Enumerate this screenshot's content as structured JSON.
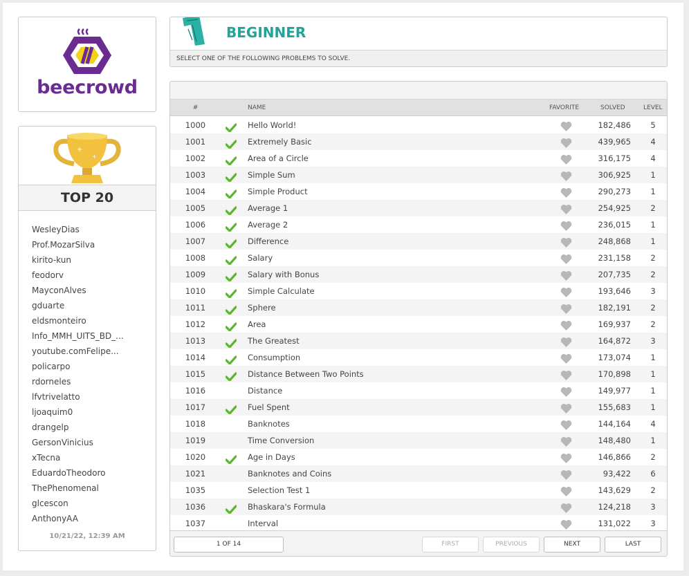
{
  "logo": {
    "text": "beecrowd"
  },
  "ranking": {
    "title": "TOP 20",
    "users": [
      "WesleyDias",
      "Prof.MozarSilva",
      "kirito-kun",
      "feodorv",
      "MayconAlves",
      "gduarte",
      "eldsmonteiro",
      "Info_MMH_UITS_BD_...",
      "youtube.comFelipe...",
      "policarpo",
      "rdorneles",
      "lfvtrivelatto",
      "ljoaquim0",
      "drangelp",
      "GersonVinicius",
      "xTecna",
      "EduardoTheodoro",
      "ThePhenomenal",
      "glcescon",
      "AnthonyAA"
    ],
    "timestamp": "10/21/22, 12:39 AM"
  },
  "category": {
    "number_icon": "1",
    "title": "BEGINNER",
    "subtitle": "SELECT ONE OF THE FOLLOWING PROBLEMS TO SOLVE."
  },
  "table": {
    "headers": {
      "id": "#",
      "name": "NAME",
      "favorite": "FAVORITE",
      "solved": "SOLVED",
      "level": "LEVEL"
    },
    "rows": [
      {
        "id": "1000",
        "done": true,
        "name": "Hello World!",
        "solved": "182,486",
        "level": "5"
      },
      {
        "id": "1001",
        "done": true,
        "name": "Extremely Basic",
        "solved": "439,965",
        "level": "4"
      },
      {
        "id": "1002",
        "done": true,
        "name": "Area of a Circle",
        "solved": "316,175",
        "level": "4"
      },
      {
        "id": "1003",
        "done": true,
        "name": "Simple Sum",
        "solved": "306,925",
        "level": "1"
      },
      {
        "id": "1004",
        "done": true,
        "name": "Simple Product",
        "solved": "290,273",
        "level": "1"
      },
      {
        "id": "1005",
        "done": true,
        "name": "Average 1",
        "solved": "254,925",
        "level": "2"
      },
      {
        "id": "1006",
        "done": true,
        "name": "Average 2",
        "solved": "236,015",
        "level": "1"
      },
      {
        "id": "1007",
        "done": true,
        "name": "Difference",
        "solved": "248,868",
        "level": "1"
      },
      {
        "id": "1008",
        "done": true,
        "name": "Salary",
        "solved": "231,158",
        "level": "2"
      },
      {
        "id": "1009",
        "done": true,
        "name": "Salary with Bonus",
        "solved": "207,735",
        "level": "2"
      },
      {
        "id": "1010",
        "done": true,
        "name": "Simple Calculate",
        "solved": "193,646",
        "level": "3"
      },
      {
        "id": "1011",
        "done": true,
        "name": "Sphere",
        "solved": "182,191",
        "level": "2"
      },
      {
        "id": "1012",
        "done": true,
        "name": "Area",
        "solved": "169,937",
        "level": "2"
      },
      {
        "id": "1013",
        "done": true,
        "name": "The Greatest",
        "solved": "164,872",
        "level": "3"
      },
      {
        "id": "1014",
        "done": true,
        "name": "Consumption",
        "solved": "173,074",
        "level": "1"
      },
      {
        "id": "1015",
        "done": true,
        "name": "Distance Between Two Points",
        "solved": "170,898",
        "level": "1"
      },
      {
        "id": "1016",
        "done": false,
        "name": "Distance",
        "solved": "149,977",
        "level": "1"
      },
      {
        "id": "1017",
        "done": true,
        "name": "Fuel Spent",
        "solved": "155,683",
        "level": "1"
      },
      {
        "id": "1018",
        "done": false,
        "name": "Banknotes",
        "solved": "144,164",
        "level": "4"
      },
      {
        "id": "1019",
        "done": false,
        "name": "Time Conversion",
        "solved": "148,480",
        "level": "1"
      },
      {
        "id": "1020",
        "done": true,
        "name": "Age in Days",
        "solved": "146,866",
        "level": "2"
      },
      {
        "id": "1021",
        "done": false,
        "name": "Banknotes and Coins",
        "solved": "93,422",
        "level": "6"
      },
      {
        "id": "1035",
        "done": false,
        "name": "Selection Test 1",
        "solved": "143,629",
        "level": "2"
      },
      {
        "id": "1036",
        "done": true,
        "name": "Bhaskara's Formula",
        "solved": "124,218",
        "level": "3"
      },
      {
        "id": "1037",
        "done": false,
        "name": "Interval",
        "solved": "131,022",
        "level": "3"
      }
    ]
  },
  "pagination": {
    "page_label": "1 OF 14",
    "first": "FIRST",
    "previous": "PREVIOUS",
    "next": "NEXT",
    "last": "LAST"
  },
  "colors": {
    "accent": "#22a49b",
    "brand": "#6a2c91",
    "brand_yellow": "#f3d21a",
    "check": "#5cb531",
    "heart": "#b8b8b8"
  }
}
